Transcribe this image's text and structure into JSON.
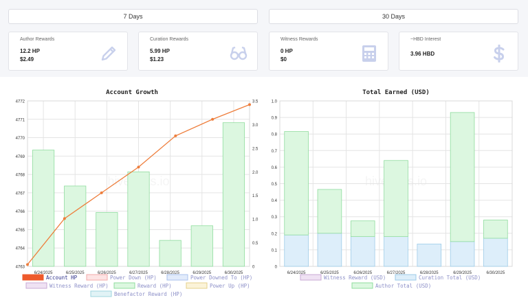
{
  "tabs": [
    {
      "label": "7 Days"
    },
    {
      "label": "30 Days"
    }
  ],
  "cards": {
    "author": {
      "label": "Author Rewards",
      "value1": "12.2 HP",
      "value2": "$2.49",
      "icon": "pencil-icon"
    },
    "curation": {
      "label": "Curation Rewards",
      "value1": "5.99 HP",
      "value2": "$1.23",
      "icon": "glasses-icon"
    },
    "witness": {
      "label": "Witness Rewards",
      "value1": "0 HP",
      "value2": "$0",
      "icon": "calculator-icon"
    },
    "hbd": {
      "label": "~HBD Interest",
      "value1": "3.96 HBD",
      "icon": "dollar-icon"
    }
  },
  "colors": {
    "accent": "#ee7d3b",
    "icon": "#c8d0ec",
    "reward_fill": "#dcf7e0",
    "reward_stroke": "#8fdc9e",
    "curation_fill": "#ddeefa",
    "curation_stroke": "#9ccbe8"
  },
  "watermark": "hivestats.io",
  "chart_data": [
    {
      "type": "bar",
      "title": "Account Growth",
      "categories": [
        "6/24/2025",
        "6/25/2025",
        "6/26/2025",
        "6/27/2025",
        "6/28/2025",
        "6/29/2025",
        "6/30/2025"
      ],
      "series": [
        {
          "name": "Account HP",
          "kind": "line",
          "axis": "left",
          "values": [
            4763.1,
            4765.6,
            4767.0,
            4768.4,
            4770.1,
            4771.0,
            4771.8
          ]
        },
        {
          "name": "Reward (HP)",
          "kind": "bar",
          "axis": "right",
          "values": [
            2.46,
            1.7,
            1.14,
            2.0,
            0.55,
            0.86,
            3.04
          ]
        }
      ],
      "legend": [
        "Account HP",
        "Power Down (HP)",
        "Power Downed To (HP)",
        "Witness Reward (HP)",
        "Reward (HP)",
        "Power Up (HP)",
        "Benefactor Reward (HP)"
      ],
      "y_left": {
        "min": 4763,
        "max": 4772,
        "ticks": [
          "4772",
          "4771",
          "4770",
          "4769",
          "4768",
          "4767",
          "4766",
          "4765",
          "4764",
          "4763"
        ]
      },
      "y_right": {
        "min": 0,
        "max": 3.5,
        "ticks": [
          "3.5",
          "3.0",
          "2.5",
          "2.0",
          "1.5",
          "1.0",
          "0.5",
          "0"
        ]
      },
      "grid": true,
      "legend_position": "bottom"
    },
    {
      "type": "bar",
      "title": "Total Earned (USD)",
      "categories": [
        "6/24/2025",
        "6/25/2025",
        "6/26/2025",
        "6/27/2025",
        "6/28/2025",
        "6/29/2025",
        "6/30/2025"
      ],
      "stacked": true,
      "series": [
        {
          "name": "Witness Reward (USD)",
          "values": [
            0,
            0,
            0,
            0,
            0,
            0,
            0
          ]
        },
        {
          "name": "Curation Total (USD)",
          "values": [
            0.19,
            0.2,
            0.18,
            0.18,
            0.135,
            0.15,
            0.17
          ]
        },
        {
          "name": "Author Total (USD)",
          "values": [
            0.625,
            0.265,
            0.095,
            0.46,
            0,
            0.78,
            0.11
          ]
        }
      ],
      "legend": [
        "Witness Reward (USD)",
        "Curation Total (USD)",
        "Author Total (USD)"
      ],
      "y": {
        "min": 0,
        "max": 1.0,
        "ticks": [
          "1.0",
          "0.9",
          "0.8",
          "0.7",
          "0.6",
          "0.5",
          "0.4",
          "0.3",
          "0.2",
          "0.1",
          "0"
        ]
      },
      "grid": true,
      "legend_position": "bottom"
    }
  ]
}
